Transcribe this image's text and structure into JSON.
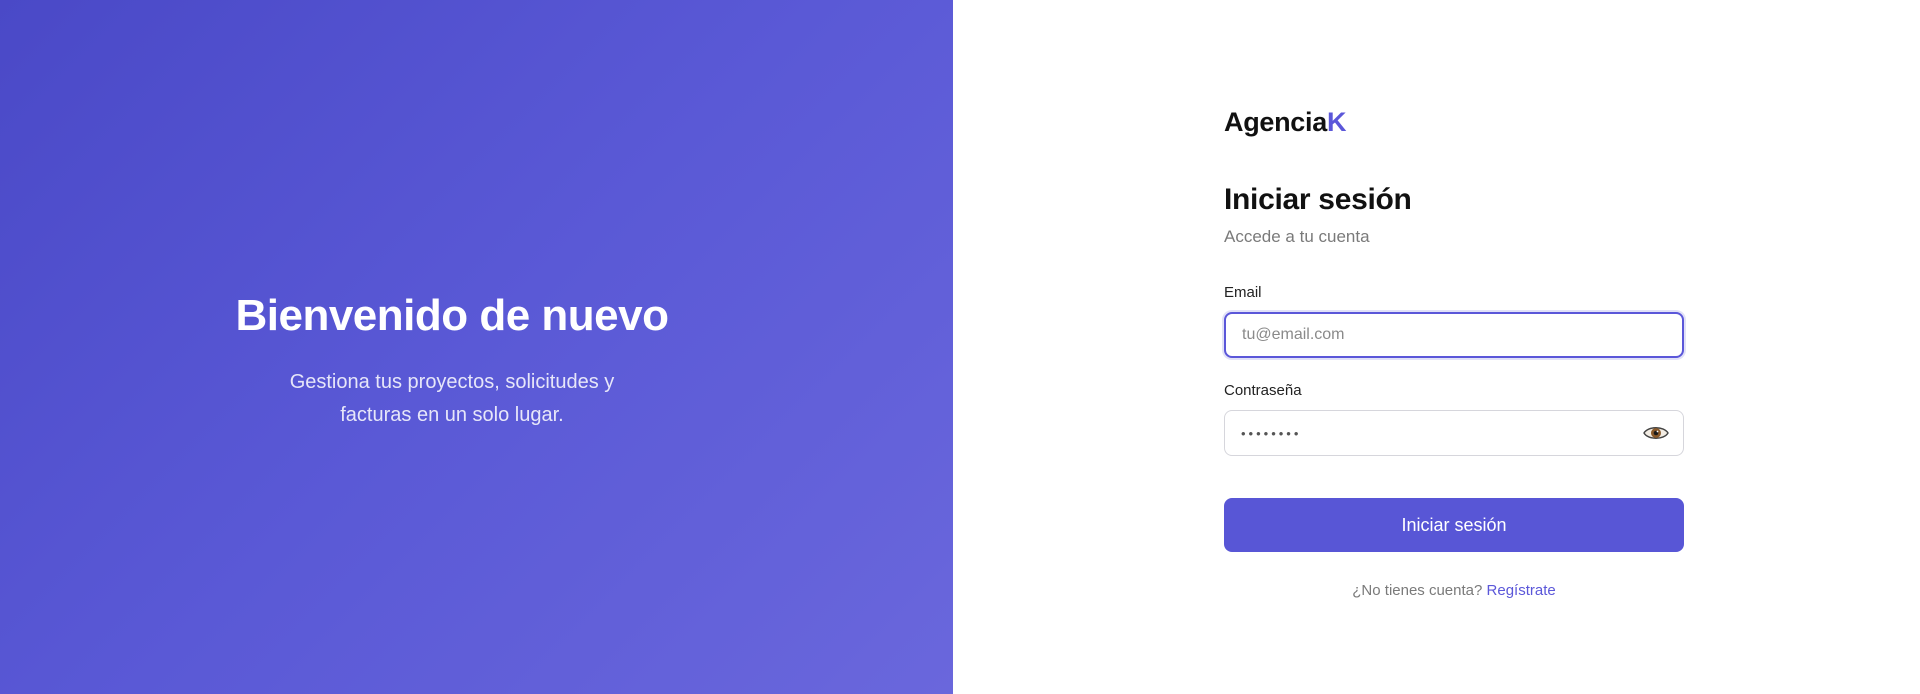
{
  "hero": {
    "title": "Bienvenido de nuevo",
    "subtitle": "Gestiona tus proyectos, solicitudes y facturas en un solo lugar."
  },
  "brand": {
    "name": "Agencia",
    "accent": "K",
    "accent_color": "#5b57d9"
  },
  "form": {
    "title": "Iniciar sesión",
    "subtitle": "Accede a tu cuenta",
    "email": {
      "label": "Email",
      "placeholder": "tu@email.com",
      "value": ""
    },
    "password": {
      "label": "Contraseña",
      "masked_value": "••••••••",
      "toggle_icon": "eye-icon"
    },
    "submit_label": "Iniciar sesión",
    "signup": {
      "prompt": "¿No tienes cuenta?",
      "link_label": "Regístrate"
    }
  },
  "colors": {
    "hero_gradient_start": "#4a49c7",
    "hero_gradient_end": "#6a67dc",
    "button": "#5856d6"
  }
}
